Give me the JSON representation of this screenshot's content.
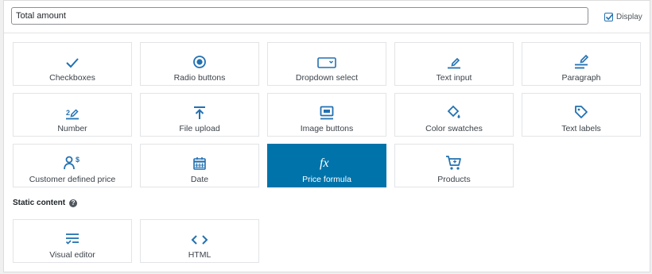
{
  "field": {
    "title_value": "Total amount",
    "display_label": "Display",
    "display_checked": true
  },
  "colors": {
    "accent": "#0073aa",
    "icon": "#2271b1",
    "tile_border": "#e2e4e7"
  },
  "field_types": [
    {
      "label": "Checkboxes",
      "icon": "checkmark-icon"
    },
    {
      "label": "Radio buttons",
      "icon": "radio-button-icon"
    },
    {
      "label": "Dropdown select",
      "icon": "dropdown-icon"
    },
    {
      "label": "Text input",
      "icon": "text-input-icon"
    },
    {
      "label": "Paragraph",
      "icon": "paragraph-icon"
    },
    {
      "label": "Number",
      "icon": "number-icon"
    },
    {
      "label": "File upload",
      "icon": "upload-icon"
    },
    {
      "label": "Image buttons",
      "icon": "image-buttons-icon"
    },
    {
      "label": "Color swatches",
      "icon": "paint-bucket-icon"
    },
    {
      "label": "Text labels",
      "icon": "tag-icon"
    },
    {
      "label": "Customer defined price",
      "icon": "customer-price-icon"
    },
    {
      "label": "Date",
      "icon": "calendar-icon"
    },
    {
      "label": "Price formula",
      "icon": "formula-icon",
      "selected": true
    },
    {
      "label": "Products",
      "icon": "cart-icon"
    }
  ],
  "static_content": {
    "title": "Static content",
    "help_glyph": "?",
    "items": [
      {
        "label": "Visual editor",
        "icon": "visual-editor-icon"
      },
      {
        "label": "HTML",
        "icon": "code-icon"
      }
    ]
  },
  "formula_glyph": "fx",
  "number_glyph": "2"
}
